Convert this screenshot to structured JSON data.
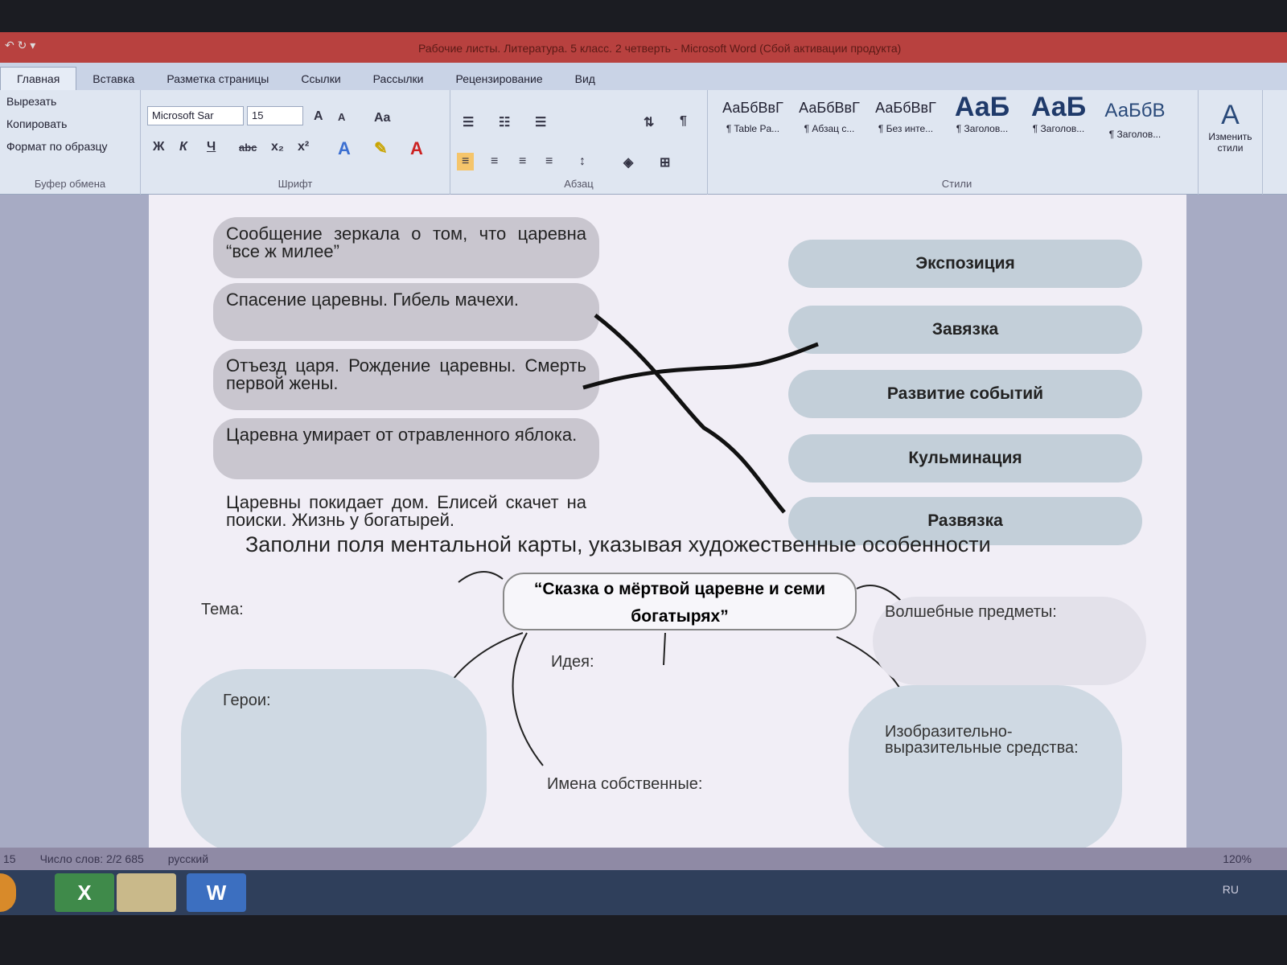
{
  "window": {
    "title": "Рабочие листы. Литература. 5 класс. 2 четверть - Microsoft Word (Сбой активации продукта)",
    "qat": "↶ ↻ ▾"
  },
  "tabs": [
    "Главная",
    "Вставка",
    "Разметка страницы",
    "Ссылки",
    "Рассылки",
    "Рецензирование",
    "Вид"
  ],
  "ribbon": {
    "clipboard": {
      "items": [
        "Вырезать",
        "Копировать",
        "Формат по образцу"
      ],
      "label": "Буфер обмена"
    },
    "font": {
      "name": "Microsoft Sar",
      "size": "15",
      "label": "Шрифт",
      "buttons": [
        "Ж",
        "К",
        "Ч",
        "abc",
        "x₂",
        "x²",
        "A",
        "A",
        "Aa"
      ]
    },
    "paragraph": {
      "label": "Абзац"
    },
    "styles": {
      "label": "Стили",
      "items": [
        {
          "sample": "АаБбВвГ",
          "name": "¶ Table Pa..."
        },
        {
          "sample": "АаБбВвГ",
          "name": "¶ Абзац с..."
        },
        {
          "sample": "АаБбВвГ",
          "name": "¶ Без инте..."
        },
        {
          "sample": "АаБ",
          "name": "¶ Заголов..."
        },
        {
          "sample": "АаБ",
          "name": "¶ Заголов..."
        },
        {
          "sample": "АаБбВ",
          "name": "¶ Заголов..."
        }
      ],
      "change": "Изменить стили"
    }
  },
  "document": {
    "events": [
      "Сообщение зеркала о том, что царевна “все ж милее”",
      "Спасение царевны. Гибель мачехи.",
      "Отъезд царя. Рождение царевны. Смерть первой жены.",
      "Царевна умирает от отравленного яблока.",
      "Царевны покидает дом. Елисей скачет на поиски. Жизнь у богатырей."
    ],
    "plot_parts": [
      "Экспозиция",
      "Завязка",
      "Развитие событий",
      "Кульминация",
      "Развязка"
    ],
    "task": "Заполни поля ментальной карты, указывая художественные особенности",
    "center_title": "“Сказка о мёртвой царевне и семи богатырях”",
    "fields": {
      "theme": "Тема:",
      "idea": "Идея:",
      "heroes": "Герои:",
      "names": "Имена собственные:",
      "magic": "Волшебные предметы:",
      "means": "Изобразительно-выразительные средства:"
    }
  },
  "status": {
    "page": "15",
    "words": "Число слов: 2/2 685",
    "language": "русский",
    "zoom": "120%"
  },
  "taskbar": {
    "apps": [
      "X",
      "",
      "W"
    ],
    "lang": "RU"
  }
}
